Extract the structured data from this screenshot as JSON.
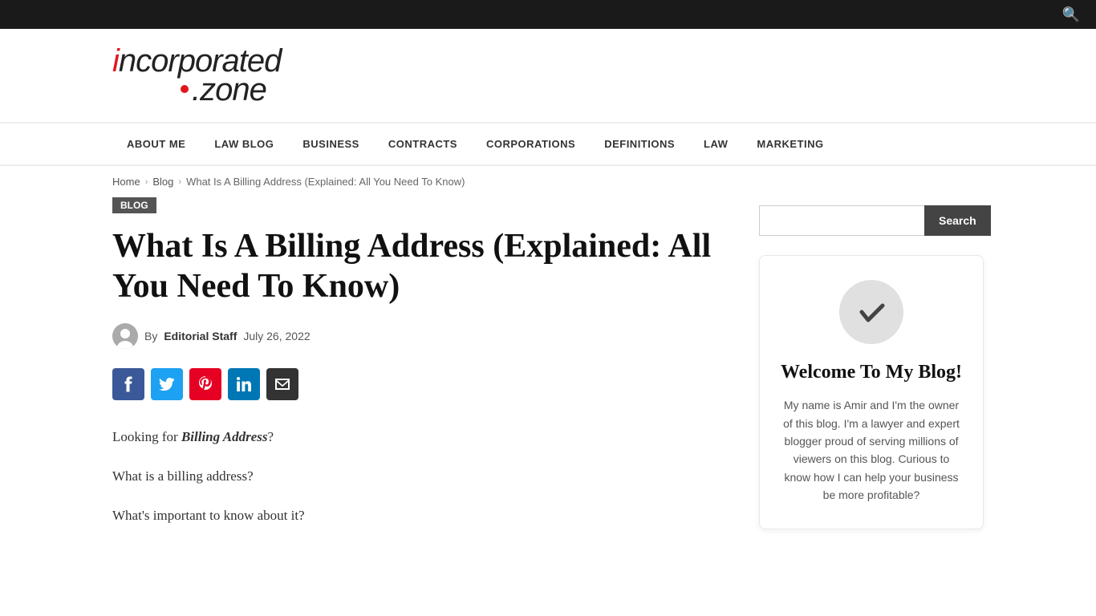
{
  "topbar": {
    "search_icon": "🔍"
  },
  "logo": {
    "line1": "incorporated",
    "line2": ".zone"
  },
  "nav": {
    "items": [
      {
        "label": "ABOUT ME",
        "href": "#"
      },
      {
        "label": "LAW BLOG",
        "href": "#"
      },
      {
        "label": "BUSINESS",
        "href": "#"
      },
      {
        "label": "CONTRACTS",
        "href": "#"
      },
      {
        "label": "CORPORATIONS",
        "href": "#"
      },
      {
        "label": "DEFINITIONS",
        "href": "#"
      },
      {
        "label": "LAW",
        "href": "#"
      },
      {
        "label": "MARKETING",
        "href": "#"
      }
    ]
  },
  "breadcrumb": {
    "home": "Home",
    "blog": "Blog",
    "current": "What Is A Billing Address (Explained: All You Need To Know)"
  },
  "article": {
    "tag": "Blog",
    "title": "What Is A Billing Address (Explained: All You Need To Know)",
    "author_by": "By",
    "author_name": "Editorial Staff",
    "date": "July 26, 2022",
    "body_p1_prefix": "Looking for ",
    "body_p1_bold_italic": "Billing Address",
    "body_p1_suffix": "?",
    "body_p2": "What is a billing address?",
    "body_p3": "What's important to know about it?"
  },
  "social": {
    "facebook": "f",
    "twitter": "t",
    "pinterest": "p",
    "linkedin": "in",
    "email": "✉"
  },
  "sidebar": {
    "search_placeholder": "",
    "search_button": "Search",
    "welcome_title": "Welcome To My Blog!",
    "welcome_icon": "✔",
    "welcome_text": "My name is Amir and I'm the owner of this blog. I'm a lawyer and expert blogger proud of serving millions of viewers on this blog. Curious to know how I can help your business be more profitable?"
  }
}
